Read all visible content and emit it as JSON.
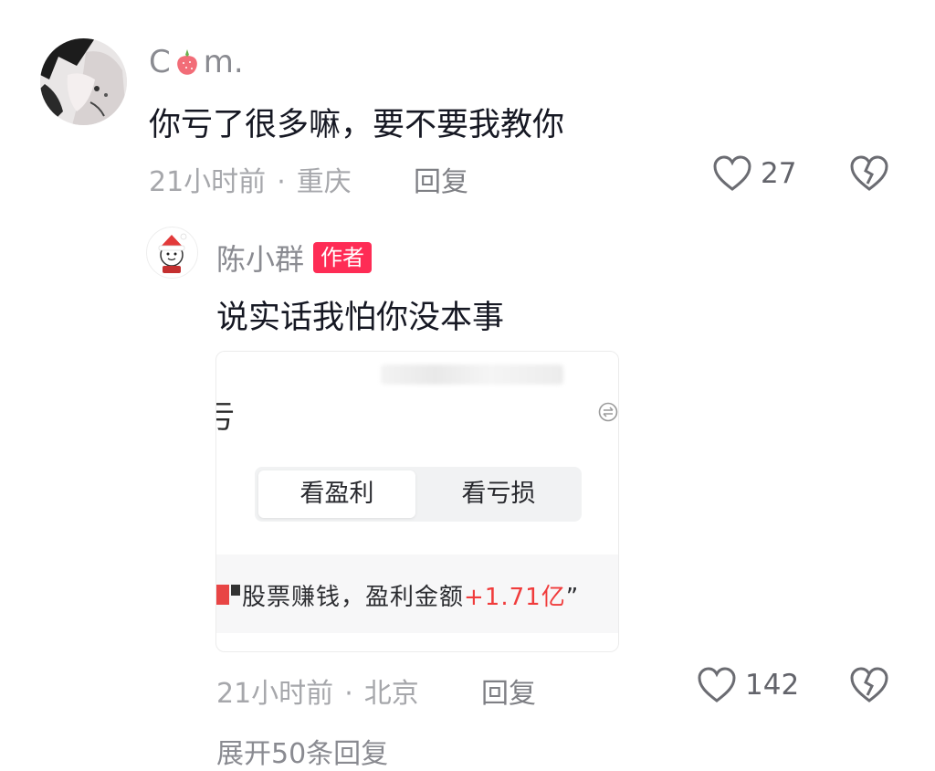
{
  "comment": {
    "username_prefix": "C",
    "username_suffix": "m.",
    "username_icon": "strawberry-icon",
    "text": "你亏了很多嘛，要不要我教你",
    "time": "21小时前",
    "dot": "·",
    "location": "重庆",
    "reply_label": "回复",
    "likes": "27",
    "like_icon": "heart-outline-icon",
    "dislike_icon": "broken-heart-icon"
  },
  "reply": {
    "username": "陈小群",
    "author_badge": "作者",
    "text": "说实话我怕你没本事",
    "time": "21小时前",
    "dot": "·",
    "location": "北京",
    "reply_label": "回复",
    "likes": "142",
    "like_icon": "heart-outline-icon",
    "dislike_icon": "broken-heart-icon",
    "attached_image": {
      "partial_title": "亏",
      "tabs": [
        "看盈利",
        "看亏损"
      ],
      "active_tab": "看盈利",
      "strip_text": "股票赚钱，盈利金额",
      "strip_amount": "+1.71亿",
      "strip_close_quote": "”",
      "accent_color": "#f03c3c"
    }
  },
  "footer": {
    "more_replies": "展开50条回复"
  },
  "colors": {
    "badge": "#fe2c55",
    "meta_text": "#a6a7ab",
    "main_text": "#161823"
  }
}
